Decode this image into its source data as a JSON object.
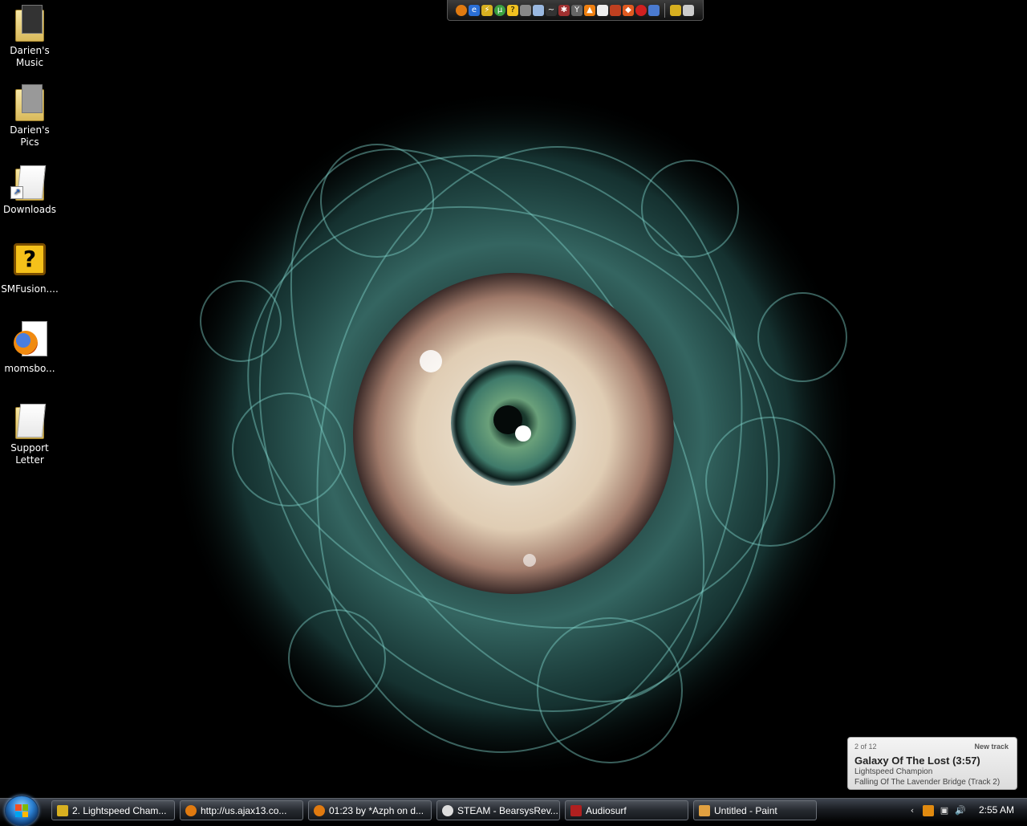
{
  "desktop": {
    "icons": [
      {
        "label": "Darien's Music"
      },
      {
        "label": "Darien's Pics"
      },
      {
        "label": "Downloads"
      },
      {
        "label": "SMFusion...."
      },
      {
        "label": "momsbo..."
      },
      {
        "label": "Support Letter"
      }
    ]
  },
  "quick_launch": {
    "icons": [
      "firefox-icon",
      "ie-icon",
      "winamp-icon",
      "utorrent-icon",
      "help-icon",
      "paint-icon",
      "finder-icon",
      "line-icon",
      "spider-icon",
      "tools-icon",
      "vlc-icon",
      "document-icon",
      "photo-icon",
      "gem-icon",
      "aim-icon",
      "mail-icon",
      "wrench-icon",
      "trash-icon"
    ]
  },
  "notification": {
    "counter": "2 of 12",
    "new_label": "New track",
    "title": "Galaxy Of The Lost (3:57)",
    "artist": "Lightspeed Champion",
    "album": "Falling Of The Lavender Bridge (Track 2)"
  },
  "taskbar": {
    "buttons": [
      {
        "label": "2. Lightspeed Cham...",
        "icon": "winamp-icon"
      },
      {
        "label": "http://us.ajax13.co...",
        "icon": "firefox-icon"
      },
      {
        "label": "01:23 by *Azph on d...",
        "icon": "firefox-icon"
      },
      {
        "label": "STEAM - BearsysRev...",
        "icon": "steam-icon"
      },
      {
        "label": "Audiosurf",
        "icon": "audiosurf-icon"
      },
      {
        "label": "Untitled - Paint",
        "icon": "paint-icon"
      }
    ],
    "clock": "2:55 AM"
  },
  "colors": {
    "wallpaper_wisp": "#5fb8b0",
    "taskbar": "#1a1d22",
    "popup": "#e8e8e8"
  }
}
